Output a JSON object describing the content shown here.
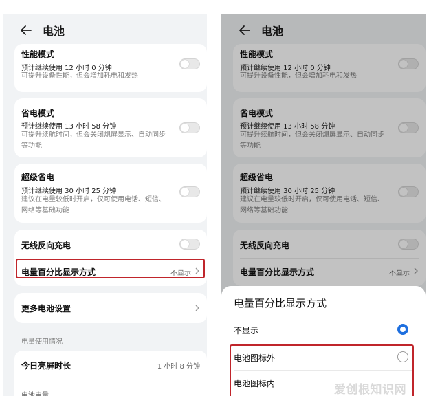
{
  "header": {
    "title": "电池"
  },
  "modes": {
    "performance": {
      "title": "性能模式",
      "subtitle": "预计继续使用 12 小时 0 分钟",
      "desc": "可提升设备性能，但会增加耗电和发热"
    },
    "power_saving": {
      "title": "省电模式",
      "subtitle": "预计继续使用 13 小时 58 分钟",
      "desc": "可提升续航时间，但会关闭熄屏显示、自动同步等功能"
    },
    "ultra_saving": {
      "title": "超级省电",
      "subtitle": "预计继续使用 30 小时 25 分钟",
      "desc": "建议在电量较低时开启，仅可使用电话、短信、网络等基础功能"
    }
  },
  "wireless": {
    "label": "无线反向充电"
  },
  "percent_display": {
    "label": "电量百分比显示方式",
    "value": "不显示"
  },
  "more_settings": {
    "label": "更多电池设置"
  },
  "usage": {
    "section_label": "电量使用情况",
    "screen_time_label": "今日亮屏时长",
    "screen_time_value": "1 小时 8 分钟",
    "battery_level_label": "电池电量"
  },
  "sheet": {
    "title": "电量百分比显示方式",
    "options": [
      {
        "label": "不显示",
        "selected": true
      },
      {
        "label": "电池图标外",
        "selected": false
      },
      {
        "label": "电池图标内",
        "selected": false
      }
    ]
  },
  "watermark": "爱创根知识网",
  "colors": {
    "highlight": "#c0252b",
    "radio_selected": "#1e6fdf",
    "panel_bg": "#f1f3f5"
  }
}
